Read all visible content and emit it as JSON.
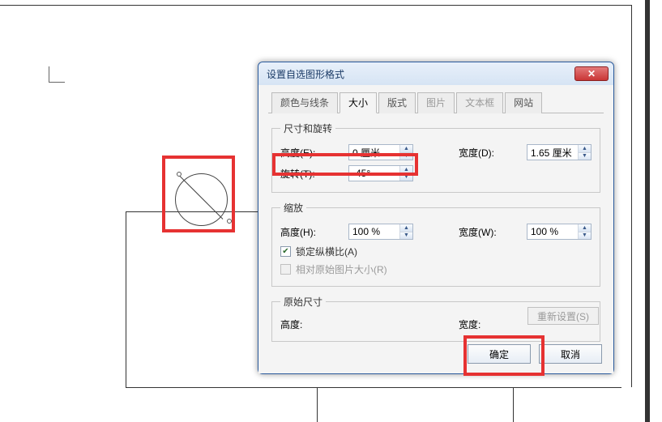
{
  "dialog": {
    "title": "设置自选图形格式",
    "tabs": {
      "colors_lines": "颜色与线条",
      "size": "大小",
      "layout": "版式",
      "picture": "图片",
      "textbox": "文本框",
      "web": "网站"
    },
    "size_rotate": {
      "legend": "尺寸和旋转",
      "height_label": "高度(E):",
      "height_value": "0 厘米",
      "width_label": "宽度(D):",
      "width_value": "1.65 厘米",
      "rotation_label": "旋转(T):",
      "rotation_value": "-45°"
    },
    "scale": {
      "legend": "缩放",
      "height_label": "高度(H):",
      "height_value": "100 %",
      "width_label": "宽度(W):",
      "width_value": "100 %",
      "lock_aspect": "锁定纵横比(A)",
      "relative_original": "相对原始图片大小(R)"
    },
    "original": {
      "legend": "原始尺寸",
      "height_label": "高度:",
      "width_label": "宽度:"
    },
    "reset": "重新设置(S)",
    "ok": "确定",
    "cancel": "取消"
  }
}
